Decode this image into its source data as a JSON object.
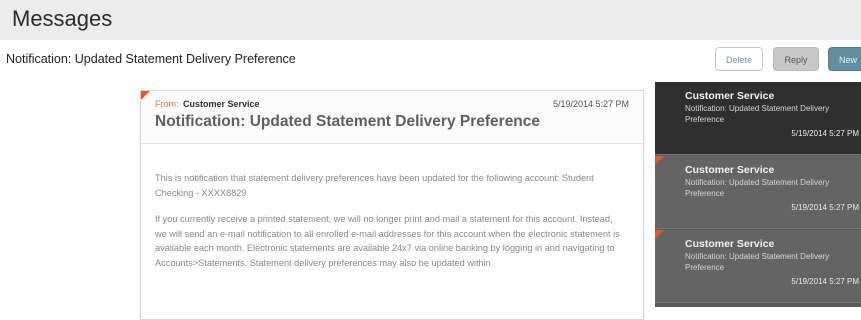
{
  "header": {
    "title": "Messages"
  },
  "toolbar": {
    "subject": "Notification: Updated Statement Delivery Preference",
    "delete_label": "Delete",
    "reply_label": "Reply",
    "new_label": "New"
  },
  "message": {
    "from_label": "From:",
    "from_name": "Customer Service",
    "date": "5/19/2014 5:27 PM",
    "subject": "Notification: Updated Statement Delivery Preference",
    "paragraphs": [
      "This is notification that statement delivery preferences have been updated for the following account: Student Checking - XXXX8829",
      "If you currently receive a printed statement, we will no longer print and mail a statement for this account. Instead, we will send an e-mail notification to all enrolled e-mail addresses for this account when the electronic statement is available each month. Electronic statements are available 24x7 via online banking by logging in and navigating to Accounts>Statements. Statement delivery preferences may also be updated within"
    ]
  },
  "inbox": {
    "items": [
      {
        "sender": "Customer Service",
        "preview": "Notification: Updated Statement Delivery Preference",
        "date": "5/19/2014 5:27 PM",
        "selected": true
      },
      {
        "sender": "Customer Service",
        "preview": "Notification: Updated Statement Delivery Preference",
        "date": "5/19/2014 5:27 PM",
        "selected": false
      },
      {
        "sender": "Customer Service",
        "preview": "Notification: Updated Statement Delivery Preference",
        "date": "5/19/2014 5:27 PM",
        "selected": false
      }
    ]
  },
  "colors": {
    "accent_flag": "#e25a2c",
    "new_button": "#5f8fa1",
    "sidebar_selected": "#2f2f2f",
    "sidebar_unselected": "#646464"
  }
}
